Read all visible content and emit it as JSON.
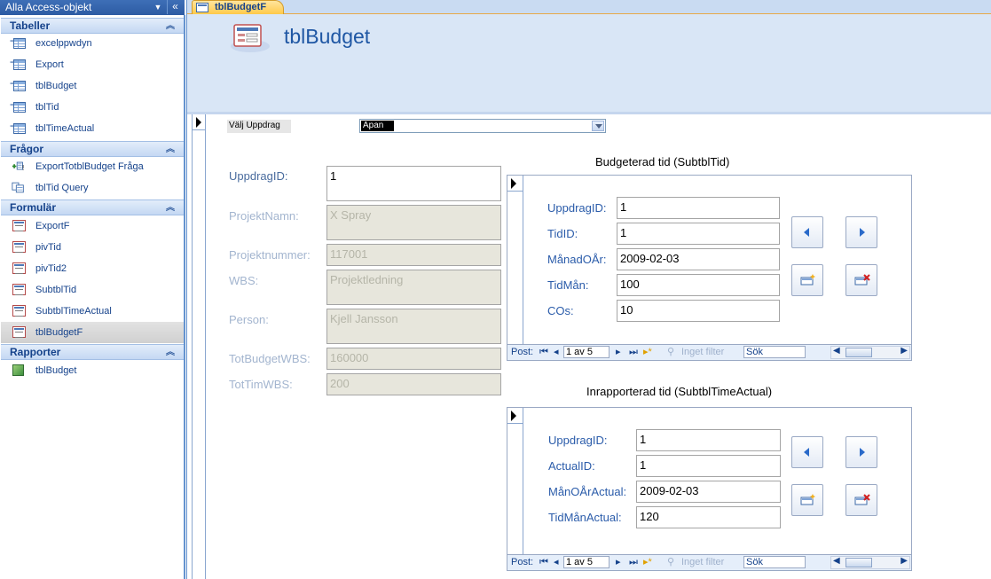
{
  "nav": {
    "header": "Alla Access-objekt",
    "groups": [
      {
        "title": "Tabeller",
        "items": [
          "excelppwdyn",
          "Export",
          "tblBudget",
          "tblTid",
          "tblTimeActual"
        ]
      },
      {
        "title": "Frågor",
        "items": [
          "ExportTotblBudget Fråga",
          "tblTid Query"
        ]
      },
      {
        "title": "Formulär",
        "items": [
          "ExportF",
          "pivTid",
          "pivTid2",
          "SubtblTid",
          "SubtblTimeActual",
          "tblBudgetF"
        ]
      },
      {
        "title": "Rapporter",
        "items": [
          "tblBudget"
        ]
      }
    ]
  },
  "tab": {
    "label": "tblBudgetF"
  },
  "form": {
    "title": "tblBudget",
    "valj_label": "Välj Uppdrag",
    "valj_value": "Apan",
    "fields": [
      {
        "label": "UppdragID:",
        "value": "1"
      },
      {
        "label": "ProjektNamn:",
        "value": "X Spray"
      },
      {
        "label": "Projektnummer:",
        "value": "117001"
      },
      {
        "label": "WBS:",
        "value": "Projektledning"
      },
      {
        "label": "Person:",
        "value": "Kjell Jansson"
      },
      {
        "label": "TotBudgetWBS:",
        "value": "160000"
      },
      {
        "label": "TotTimWBS:",
        "value": "200"
      }
    ]
  },
  "subform1": {
    "title": "Budgeterad tid (SubtblTid)",
    "fields": [
      {
        "label": "UppdragID:",
        "value": "1"
      },
      {
        "label": "TidID:",
        "value": "1"
      },
      {
        "label": "MånadOÅr:",
        "value": "2009-02-03"
      },
      {
        "label": "TidMån:",
        "value": "100"
      },
      {
        "label": "COs:",
        "value": "10"
      }
    ],
    "nav": {
      "post": "Post:",
      "record": "1 av 5",
      "filter": "Inget filter",
      "search": "Sök"
    }
  },
  "subform2": {
    "title": "Inrapporterad tid (SubtblTimeActual)",
    "fields": [
      {
        "label": "UppdragID:",
        "value": "1"
      },
      {
        "label": "ActualID:",
        "value": "1"
      },
      {
        "label": "MånOÅrActual:",
        "value": "2009-02-03"
      },
      {
        "label": "TidMånActual:",
        "value": "120"
      }
    ],
    "nav": {
      "post": "Post:",
      "record": "1 av 5",
      "filter": "Inget filter",
      "search": "Sök"
    }
  }
}
